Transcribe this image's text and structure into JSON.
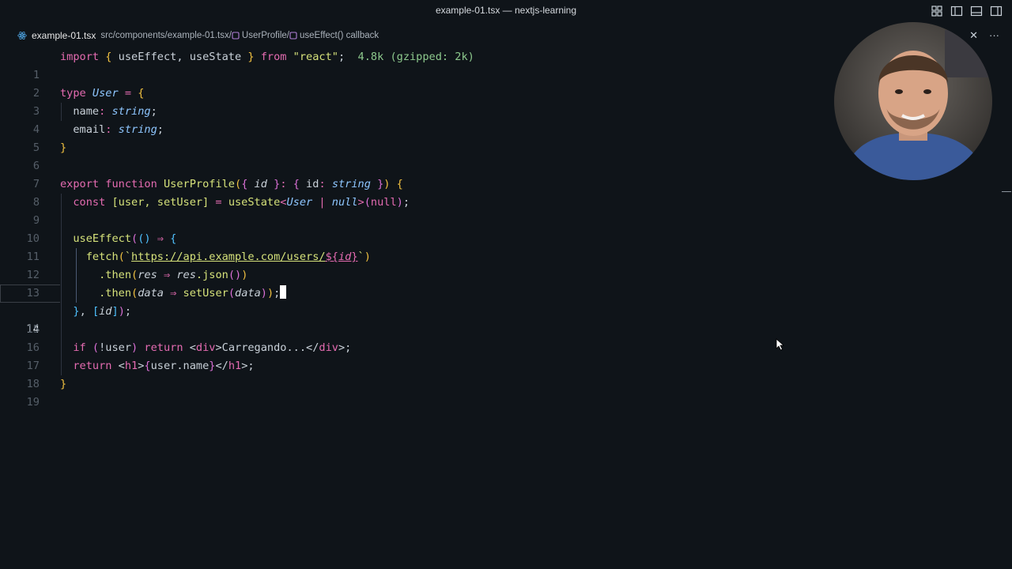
{
  "window": {
    "title": "example-01.tsx — nextjs-learning"
  },
  "breadcrumb": {
    "file": "example-01.tsx",
    "path": "src/components/example-01.tsx/",
    "symbol1": "UserProfile/",
    "symbol2": "useEffect() callback"
  },
  "tab_actions": {
    "close": "✕",
    "more": "···"
  },
  "editor": {
    "active_line": "14",
    "line_numbers": [
      "1",
      "2",
      "3",
      "4",
      "5",
      "6",
      "7",
      "8",
      "9",
      "10",
      "11",
      "12",
      "13",
      "14",
      "15",
      "16",
      "17",
      "18",
      "19"
    ],
    "l1": {
      "import": "import",
      "b1": "{",
      "useEffect": " useEffect, ",
      "useState": "useState",
      "b2": " }",
      "from": " from ",
      "str": "\"react\"",
      "semi": ";",
      "hint": "  4.8k (gzipped: 2k)"
    },
    "l3": {
      "type": "type ",
      "name": "User",
      "eq": " = ",
      "b": "{"
    },
    "l4": {
      "key": "  name",
      "colon": ": ",
      "t": "string",
      "semi": ";"
    },
    "l5": {
      "key": "  email",
      "colon": ": ",
      "t": "string",
      "semi": ";"
    },
    "l6": {
      "b": "}"
    },
    "l8": {
      "export": "export ",
      "function": "function ",
      "fname": "UserProfile",
      "p1": "(",
      "b1": "{",
      "id": " id",
      "b2": " }",
      "colon": ": ",
      "b3": "{",
      "id2": " id",
      "colon2": ": ",
      "t": "string",
      "b4": " }",
      "p2": ")",
      "sp": " ",
      "b5": "{"
    },
    "l9": {
      "const": "  const ",
      "arr": "[user, setUser]",
      "eq": " = ",
      "fn": "useState",
      "lt": "<",
      "t": "User",
      "pipe": " | ",
      "null1": "null",
      "gt": ">",
      "p1": "(",
      "null2": "null",
      "p2": ")",
      "semi": ";"
    },
    "l11": {
      "fn": "  useEffect",
      "p1": "(",
      "p2": "()",
      "arrow": " ⇒ ",
      "b": "{"
    },
    "l12": {
      "fn": "    fetch",
      "p1": "(",
      "tick": "`",
      "url": "https://api.example.com/users/",
      "interp_open": "${",
      "id": "id",
      "interp_close": "}",
      "tick2": "`",
      "p2": ")"
    },
    "l13": {
      "dot": "      .then",
      "p1": "(",
      "arg": "res",
      "arrow": " ⇒ ",
      "obj": "res",
      "call": ".json",
      "p2": "()",
      "p3": ")"
    },
    "l14": {
      "dot": "      .then",
      "p1": "(",
      "arg": "data",
      "arrow": " ⇒ ",
      "fn": "setUser",
      "p2": "(",
      "arg2": "data",
      "p3": ")",
      "p4": ")",
      "semi": ";"
    },
    "l15": {
      "b": "  }",
      "comma": ", ",
      "arr_open": "[",
      "id": "id",
      "arr_close": "]",
      "p": ")",
      "semi": ";"
    },
    "l17": {
      "if": "  if ",
      "p1": "(",
      "neg": "!user",
      "p2": ")",
      "ret": " return ",
      "lt": "<",
      "tag": "div",
      "gt": ">",
      "text": "Carregando...",
      "lt2": "</",
      "tag2": "div",
      "gt2": ">",
      "semi": ";"
    },
    "l18": {
      "ret": "  return ",
      "lt": "<",
      "tag": "h1",
      "gt": ">",
      "b1": "{",
      "expr": "user.name",
      "b2": "}",
      "lt2": "</",
      "tag2": "h1",
      "gt2": ">",
      "semi": ";"
    },
    "l19": {
      "b": "}"
    }
  }
}
